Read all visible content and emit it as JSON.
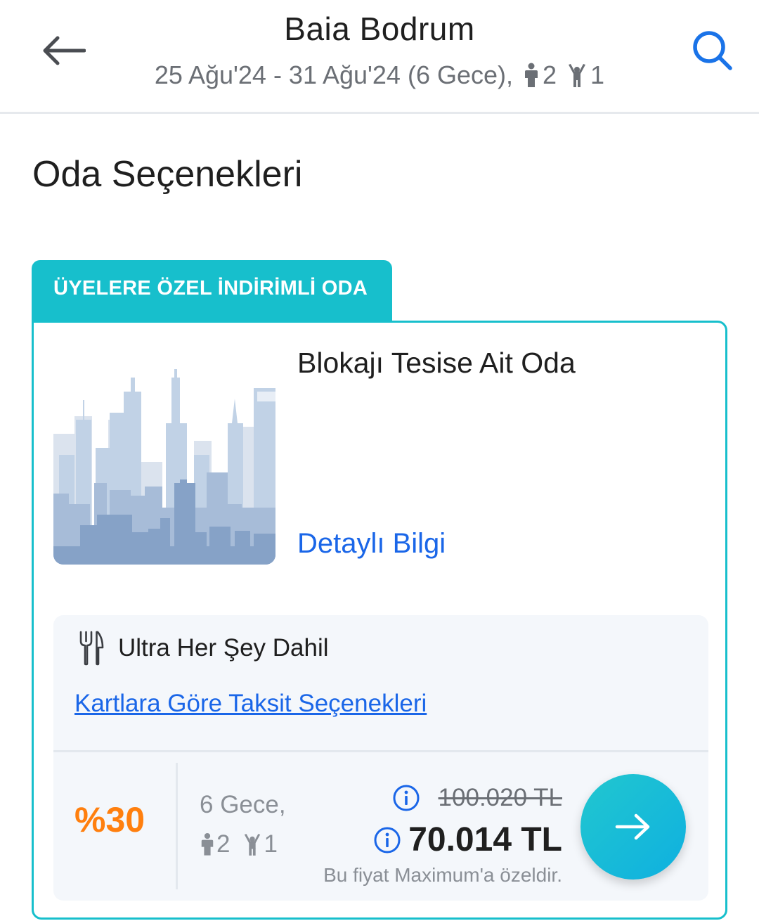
{
  "header": {
    "title": "Baia Bodrum",
    "dates": "25 Ağu'24 - 31 Ağu'24 (6 Gece),",
    "adults": "2",
    "children": "1"
  },
  "section_title": "Oda Seçenekleri",
  "promo_tag": "ÜYELERE ÖZEL İNDİRİMLİ ODA",
  "room": {
    "name": "Blokajı Tesise Ait Oda",
    "detail_link": "Detaylı Bilgi",
    "board": "Ultra Her Şey Dahil",
    "installment_link": "Kartlara Göre Taksit Seçenekleri",
    "discount": "%30",
    "nights": "6 Gece,",
    "adults": "2",
    "children": "1",
    "old_price": "100.020 TL",
    "new_price": "70.014 TL",
    "price_note": "Bu fiyat Maximum'a özeldir."
  },
  "colors": {
    "accent_teal": "#17bfcc",
    "link_blue": "#1a66e8",
    "discount_orange": "#ff7f0e"
  },
  "icons": [
    "arrow-left-icon",
    "search-icon",
    "adult-icon",
    "child-icon",
    "cutlery-icon",
    "info-icon",
    "arrow-right-icon",
    "city-placeholder-image"
  ]
}
